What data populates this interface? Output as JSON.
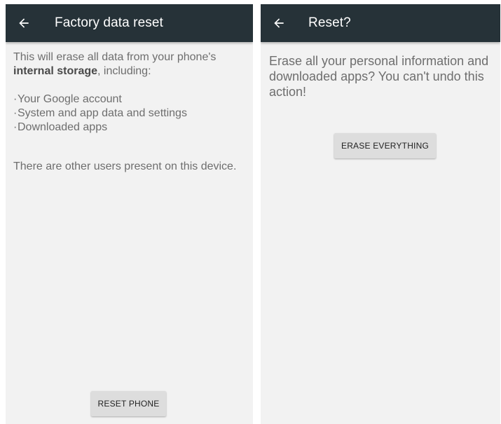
{
  "left": {
    "title": "Factory data reset",
    "intro_text": "This will erase all data from your phone's ",
    "intro_bold": "internal storage",
    "intro_tail": ", including:",
    "bullets": [
      "Your Google account",
      "System and app data and settings",
      "Downloaded apps"
    ],
    "bullet_marker": "·",
    "users_note": "There are other users present on this device.",
    "button_label": "RESET PHONE",
    "back_icon": "arrow-back-icon"
  },
  "right": {
    "title": "Reset?",
    "message": "Erase all your personal information and downloaded apps? You can't undo this action!",
    "button_label": "ERASE EVERYTHING",
    "back_icon": "arrow-back-icon"
  },
  "colors": {
    "appbar": "#263238",
    "background": "#f2f2f2",
    "body_text": "#6e6e6e",
    "button": "#dddddd"
  }
}
